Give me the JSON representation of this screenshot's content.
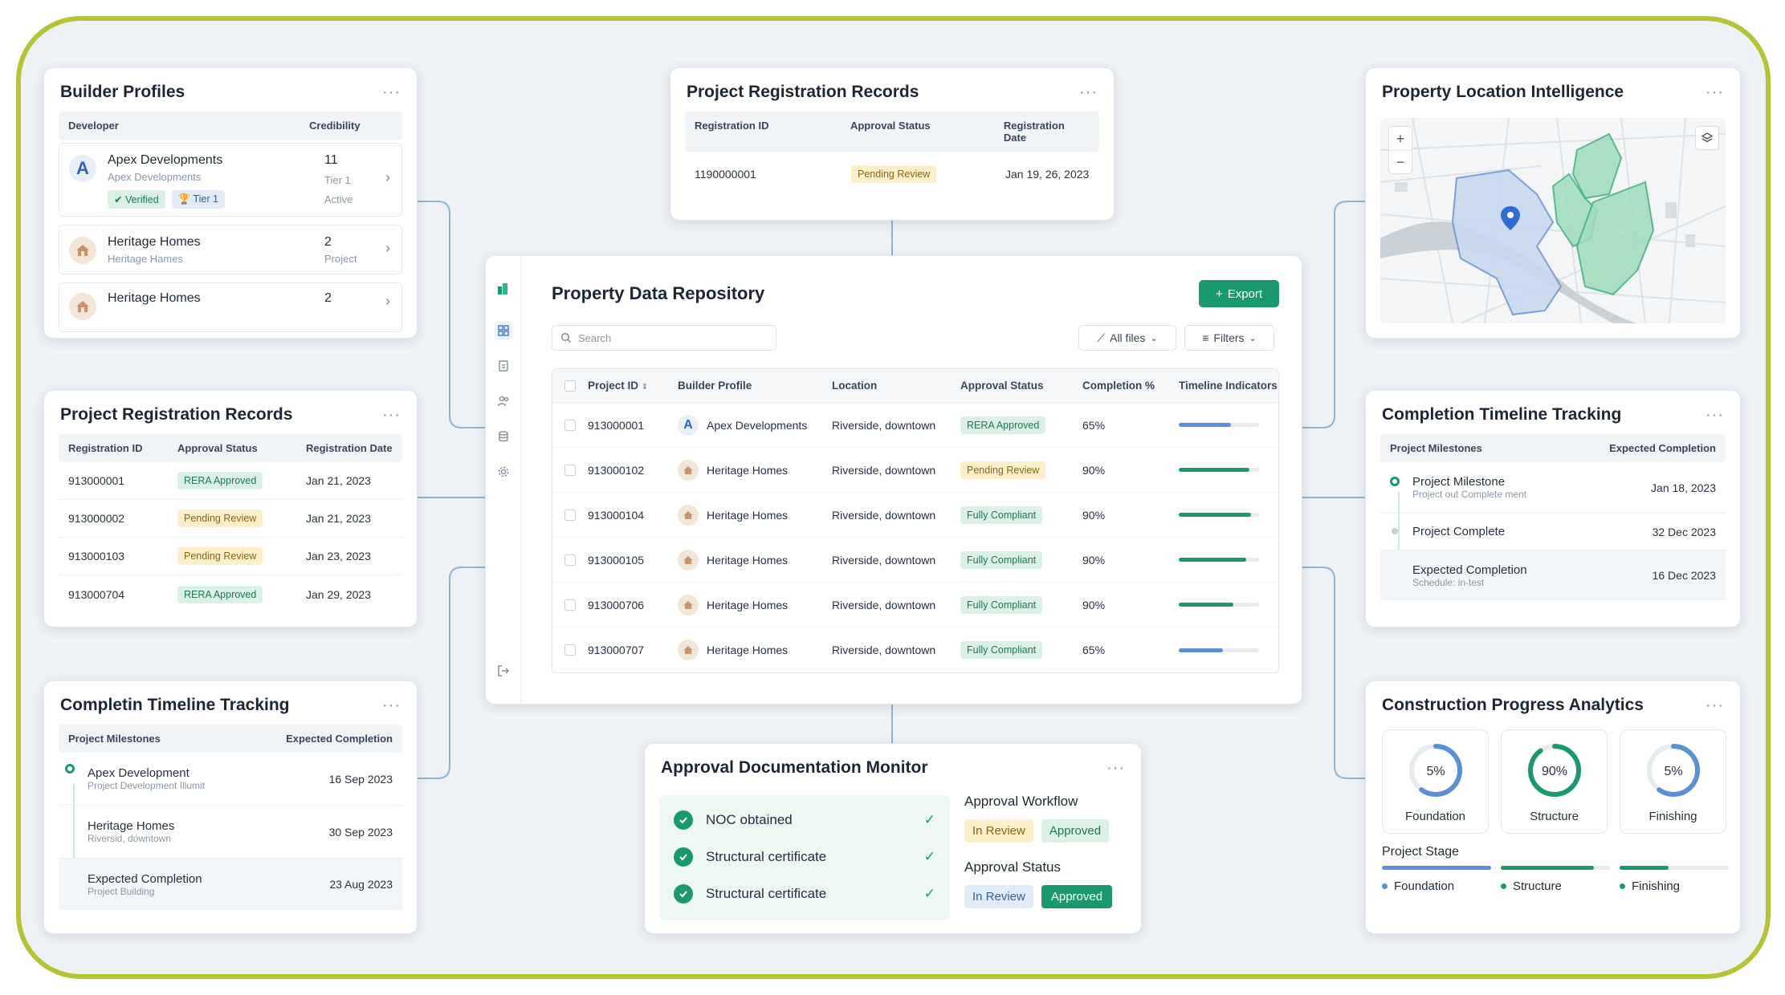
{
  "builder_profiles": {
    "title": "Builder Profiles",
    "more": "···",
    "col_developer": "Developer",
    "col_credibility": "Credibility",
    "rows": [
      {
        "name": "Apex Developments",
        "sub": "Apex Developments",
        "verified": "Verified",
        "tier": "Tier 1",
        "num": "11",
        "line2": "Tier 1",
        "line3": "Active"
      },
      {
        "name": "Heritage Homes",
        "sub": "Heritage Hames",
        "num": "2",
        "line2": "Project"
      },
      {
        "name": "Heritage Homes",
        "num": "2"
      }
    ]
  },
  "top_registration": {
    "title": "Project Registration Records",
    "more": "···",
    "col_id": "Registration ID",
    "col_status": "Approval Status",
    "col_date": "Registration Date",
    "row": {
      "id": "1190000001",
      "status": "Pending Review",
      "date": "Jan 19, 26, 2023"
    }
  },
  "location": {
    "title": "Property Location Intelligence",
    "more": "···",
    "zoom_in": "+",
    "zoom_out": "−"
  },
  "left_registration": {
    "title": "Project Registration Records",
    "more": "···",
    "col_id": "Registration ID",
    "col_status": "Approval Status",
    "col_date": "Registration Date",
    "rows": [
      {
        "id": "913000001",
        "status": "RERA Approved",
        "date": "Jan 21, 2023"
      },
      {
        "id": "913000002",
        "status": "Pending Review",
        "date": "Jan 21, 2023"
      },
      {
        "id": "913000103",
        "status": "Pending Review",
        "date": "Jan 23, 2023"
      },
      {
        "id": "913000704",
        "status": "RERA Approved",
        "date": "Jan 29, 2023"
      }
    ]
  },
  "repository": {
    "title": "Property Data Repository",
    "export": "Export",
    "search_placeholder": "Search",
    "all_files": "All files",
    "filters": "Filters",
    "columns": [
      "Project ID",
      "Builder Profile",
      "Location",
      "Approval Status",
      "Completion %",
      "Timeline Indicators"
    ],
    "rows": [
      {
        "id": "913000001",
        "builder": "Apex Developments",
        "location": "Riverside, downtown",
        "status": "RERA Approved",
        "pct": "65%",
        "progress": 0.65
      },
      {
        "id": "913000102",
        "builder": "Heritage Homes",
        "location": "Riverside, downtown",
        "status": "Pending Review",
        "pct": "90%",
        "progress": 0.88
      },
      {
        "id": "913000104",
        "builder": "Heritage Homes",
        "location": "Riverside, downtown",
        "status": "Fully Compliant",
        "pct": "90%",
        "progress": 0.9
      },
      {
        "id": "913000105",
        "builder": "Heritage Homes",
        "location": "Riverside, downtown",
        "status": "Fully Compliant",
        "pct": "90%",
        "progress": 0.84
      },
      {
        "id": "913000706",
        "builder": "Heritage Homes",
        "location": "Riverside, downtown",
        "status": "Fully Compliant",
        "pct": "90%",
        "progress": 0.68
      },
      {
        "id": "913000707",
        "builder": "Heritage Homes",
        "location": "Riverside, downtown",
        "status": "Fully Compliant",
        "pct": "65%",
        "progress": 0.55
      }
    ]
  },
  "completion_right": {
    "title": "Completion Timeline Tracking",
    "more": "···",
    "col_milestones": "Project Milestones",
    "col_expected": "Expected Completion",
    "rows": [
      {
        "name": "Project Milestone",
        "sub": "Project out Complete ment",
        "date": "Jan 18, 2023"
      },
      {
        "name": "Project Complete",
        "sub": "",
        "date": "32 Dec 2023"
      },
      {
        "name": "Expected Completion",
        "sub": "Schedule: in-test",
        "date": "16 Dec 2023"
      }
    ]
  },
  "completion_left": {
    "title": "Completin Timeline Tracking",
    "more": "···",
    "col_milestones": "Project Milestones",
    "col_expected": "Expected Completion",
    "rows": [
      {
        "name": "Apex Development",
        "sub": "Project Development Illumit",
        "date": "16 Sep 2023"
      },
      {
        "name": "Heritage Homes",
        "sub": "Riversid, downtown",
        "date": "30 Sep 2023"
      },
      {
        "name": "Expected Completion",
        "sub": "Project Building",
        "date": "23 Aug 2023"
      }
    ]
  },
  "approval": {
    "title": "Approval Documentation Monitor",
    "more": "···",
    "checks": [
      "NOC obtained",
      "Structural certificate",
      "Structural certificate"
    ],
    "workflow_label": "Approval Workflow",
    "workflow_tags": [
      "In Review",
      "Approved"
    ],
    "status_label": "Approval Status",
    "status_tags": [
      "In Review",
      "Approved"
    ]
  },
  "construction": {
    "title": "Construction Progress Analytics",
    "more": "···",
    "rings": [
      {
        "label": "Foundation",
        "text": "5%",
        "value": 0.05
      },
      {
        "label": "Structure",
        "text": "90%",
        "value": 0.9
      },
      {
        "label": "Finishing",
        "text": "5%",
        "value": 0.05
      }
    ],
    "stage_label": "Project Stage",
    "stages": [
      {
        "label": "Foundation",
        "value": 1.0
      },
      {
        "label": "Structure",
        "value": 0.85
      },
      {
        "label": "Finishing",
        "value": 0.45
      }
    ]
  },
  "colors": {
    "accent": "#1a9a6c",
    "frame": "#b5c434",
    "blue": "#5b8fd6"
  }
}
